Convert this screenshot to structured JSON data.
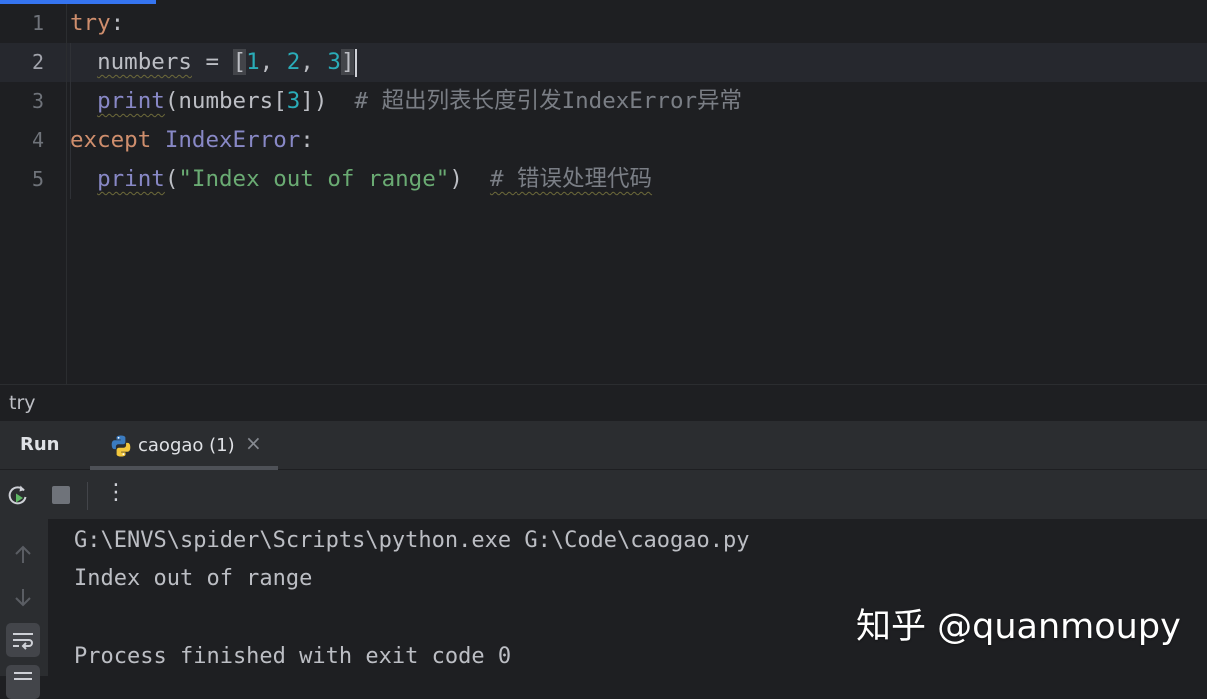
{
  "editor": {
    "line_numbers": [
      "1",
      "2",
      "3",
      "4",
      "5"
    ],
    "code": {
      "l1_kw": "try",
      "l1_colon": ":",
      "l2_indent": "  ",
      "l2_var": "numbers",
      "l2_eq": " = ",
      "l2_open": "[",
      "l2_n1": "1",
      "l2_c1": ", ",
      "l2_n2": "2",
      "l2_c2": ", ",
      "l2_n3": "3",
      "l2_close": "]",
      "l3_indent": "  ",
      "l3_fn": "print",
      "l3_args_a": "(numbers[",
      "l3_idx": "3",
      "l3_args_b": "])",
      "l3_gap": "  ",
      "l3_comment": "# 超出列表长度引发IndexError异常",
      "l4_kw": "except",
      "l4_space": " ",
      "l4_exc": "IndexError",
      "l4_colon": ":",
      "l5_indent": "  ",
      "l5_fn": "print",
      "l5_open": "(",
      "l5_str": "\"Index out of range\"",
      "l5_close": ")",
      "l5_gap": "  ",
      "l5_hash": "# ",
      "l5_comment": "错误处理代码"
    }
  },
  "breadcrumb": "try",
  "run_panel": {
    "title": "Run",
    "tab_label": "caogao (1)",
    "tab_close": "×",
    "more_glyph": "⋮"
  },
  "console": {
    "lines": [
      "G:\\ENVS\\spider\\Scripts\\python.exe G:\\Code\\caogao.py",
      "Index out of range",
      "",
      "Process finished with exit code 0"
    ]
  },
  "watermark": "知乎 @quanmoupy",
  "colors": {
    "keyword": "#cf8e6d",
    "builtin": "#8888c6",
    "number": "#2aacb8",
    "string": "#6aab73",
    "comment": "#7a7e85",
    "accent": "#3574f0"
  }
}
